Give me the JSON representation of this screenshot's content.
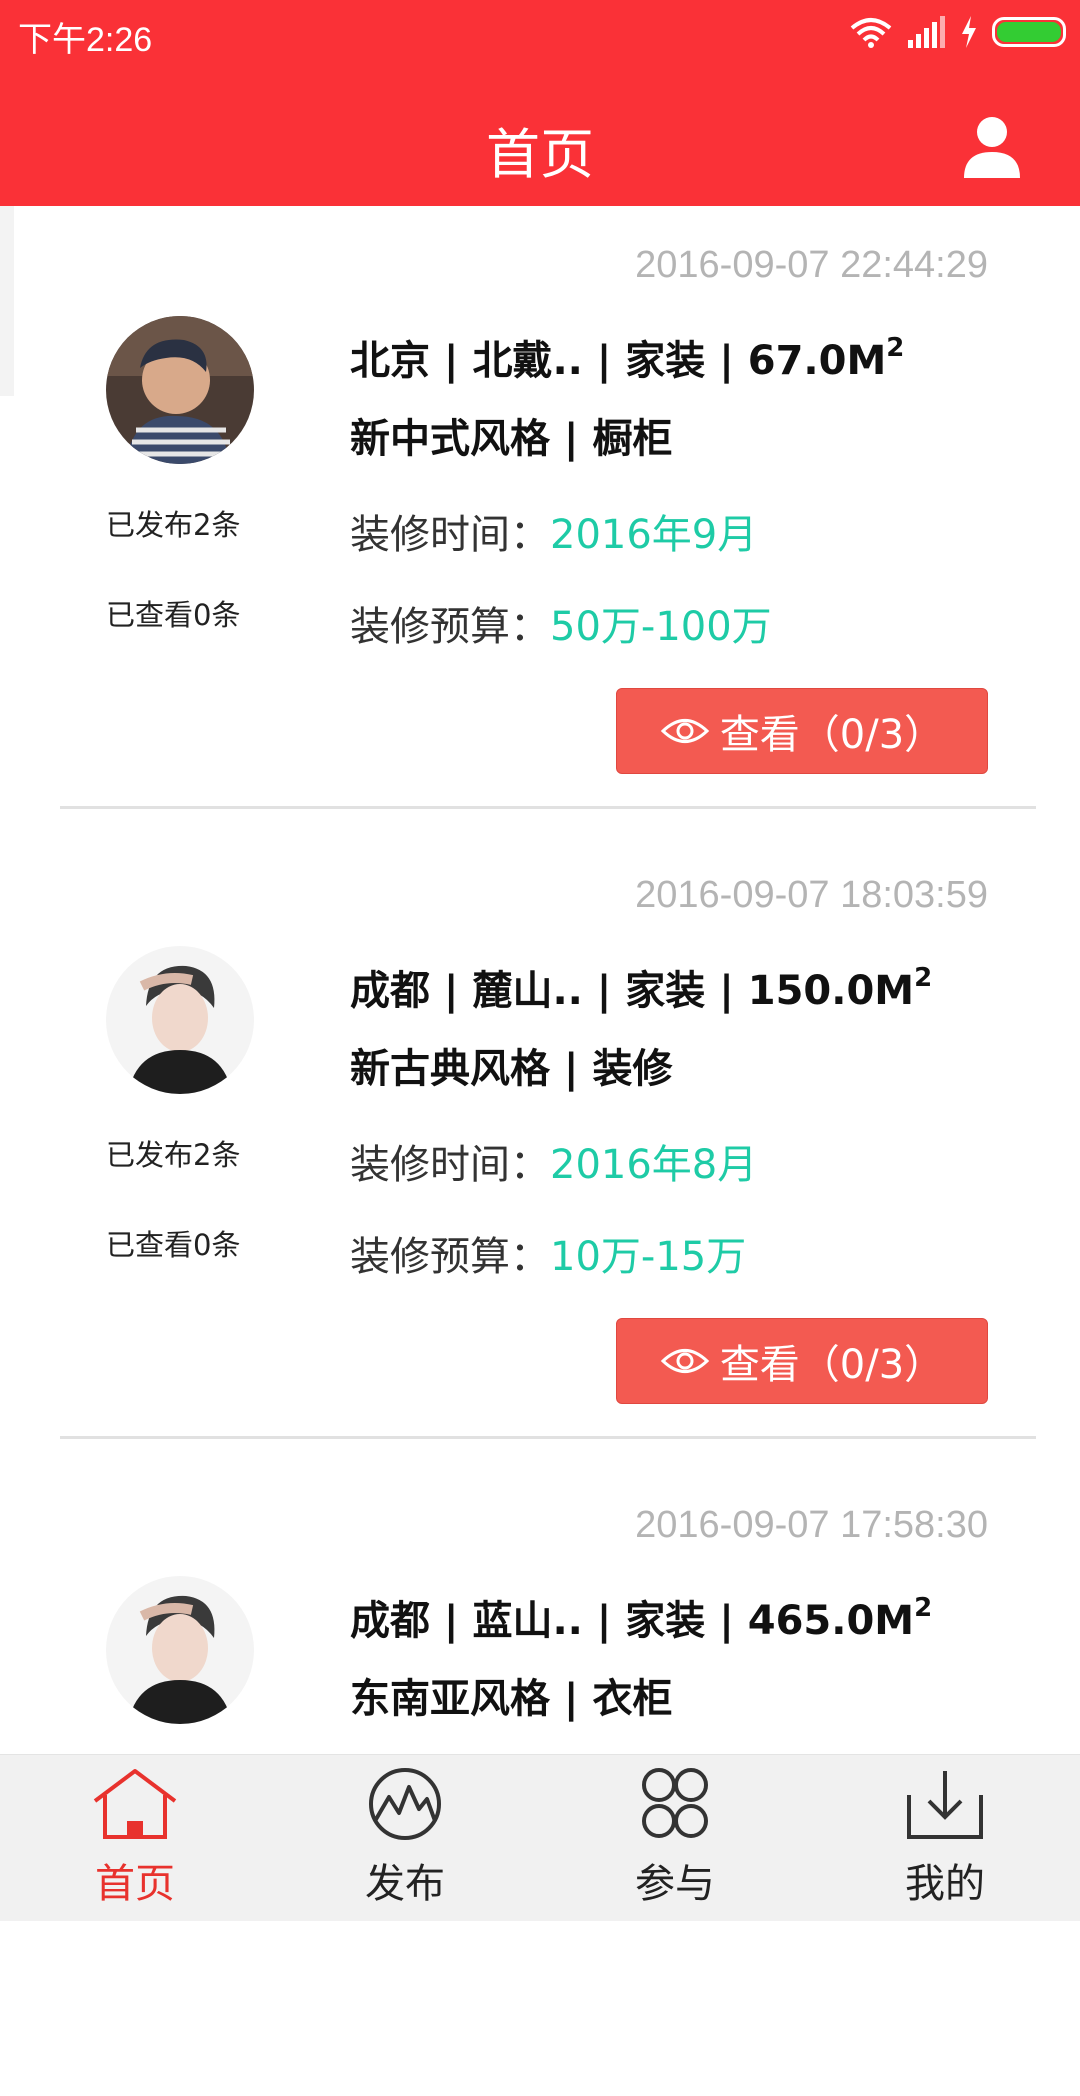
{
  "status_bar": {
    "time": "下午2:26"
  },
  "header": {
    "title": "首页"
  },
  "posts": [
    {
      "timestamp": "2016-09-07 22:44:29",
      "location": "北京 | 北戴.. | 家装 | 67.0M",
      "area_sup": "2",
      "style": "新中式风格 | 橱柜",
      "posted": "已发布2条",
      "viewed": "已查看0条",
      "time_label": "装修时间：",
      "time_value": "2016年9月",
      "budget_label": "装修预算：",
      "budget_value": "50万-100万",
      "view_button": "查看（0/3）"
    },
    {
      "timestamp": "2016-09-07 18:03:59",
      "location": "成都 | 麓山.. | 家装 | 150.0M",
      "area_sup": "2",
      "style": "新古典风格 | 装修",
      "posted": "已发布2条",
      "viewed": "已查看0条",
      "time_label": "装修时间：",
      "time_value": "2016年8月",
      "budget_label": "装修预算：",
      "budget_value": "10万-15万",
      "view_button": "查看（0/3）"
    },
    {
      "timestamp": "2016-09-07 17:58:30",
      "location": "成都 | 蓝山.. | 家装 | 465.0M",
      "area_sup": "2",
      "style": "东南亚风格 | 衣柜"
    }
  ],
  "tabs": [
    {
      "label": "首页",
      "icon": "home-icon",
      "active": true
    },
    {
      "label": "发布",
      "icon": "publish-icon"
    },
    {
      "label": "参与",
      "icon": "participate-icon"
    },
    {
      "label": "我的",
      "icon": "download-icon"
    }
  ],
  "colors": {
    "header": "#fa3137",
    "accent_value": "#1ecba6",
    "button": "#f35a51",
    "tab_active": "#e8322d"
  }
}
